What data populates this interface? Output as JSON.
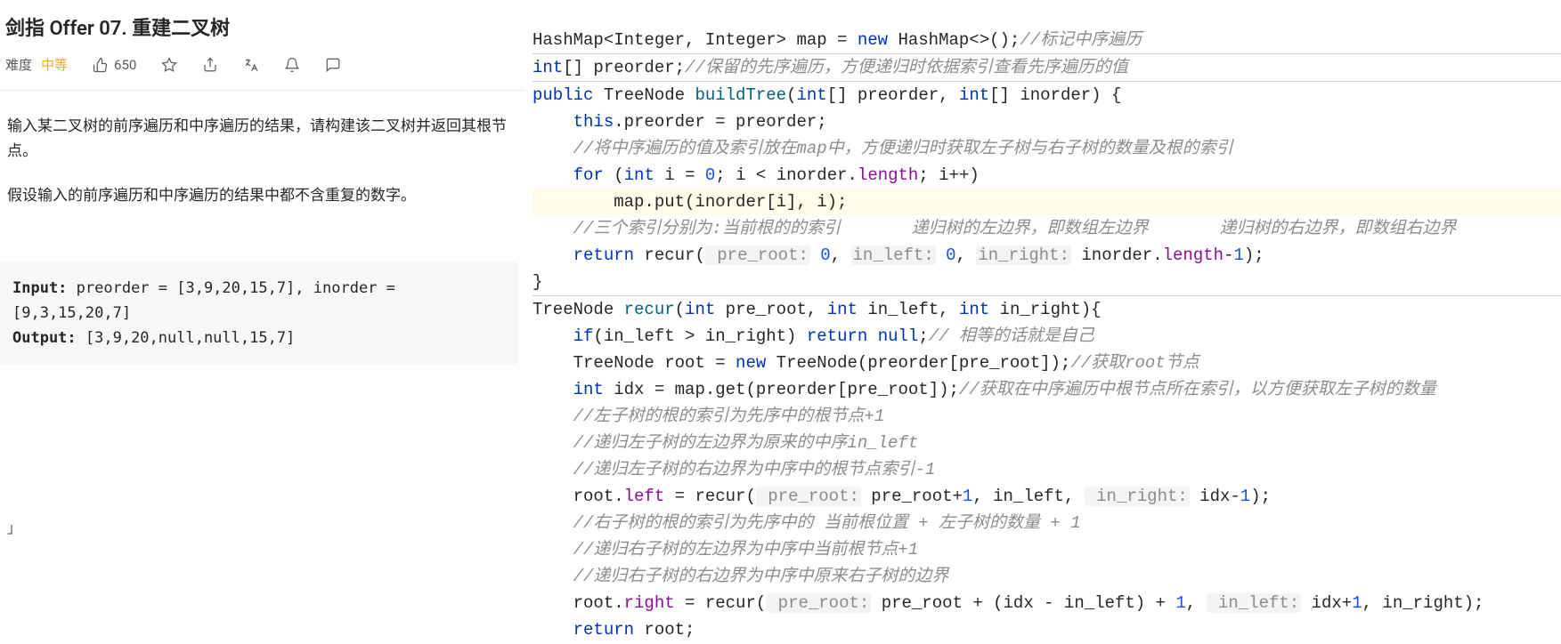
{
  "problem": {
    "title": "剑指 Offer 07. 重建二叉树",
    "difficulty_label": "难度",
    "difficulty_value": "中等",
    "likes": "650",
    "desc1": "输入某二叉树的前序遍历和中序遍历的结果，请构建该二叉树并返回其根节点。",
    "desc2": "假设输入的前序遍历和中序遍历的结果中都不含重复的数字。",
    "example": {
      "input_label": "Input:",
      "input_text": " preorder = [3,9,20,15,7], inorder = [9,3,15,20,7]",
      "output_label": "Output:",
      "output_text": " [3,9,20,null,null,15,7]"
    },
    "trail": "」"
  },
  "code": {
    "l1_a": "HashMap<Integer, Integer> map = ",
    "l1_new": "new",
    "l1_b": " HashMap<>();",
    "l1_c": "//标记中序遍历",
    "l2_a": "int",
    "l2_b": "[] preorder;",
    "l2_c": "//保留的先序遍历，方便递归时依据索引查看先序遍历的值",
    "l3_a": "public",
    "l3_b": " TreeNode ",
    "l3_m": "buildTree",
    "l3_c": "(",
    "l3_int1": "int",
    "l3_d": "[] preorder, ",
    "l3_int2": "int",
    "l3_e": "[] inorder) {",
    "l4_a": "    ",
    "l4_this": "this",
    "l4_b": ".preorder = preorder;",
    "l5": "    //将中序遍历的值及索引放在map中，方便递归时获取左子树与右子树的数量及根的索引",
    "l6_a": "    ",
    "l6_for": "for",
    "l6_b": " (",
    "l6_int": "int",
    "l6_c": " i = ",
    "l6_z": "0",
    "l6_d": "; i < inorder.",
    "l6_len": "length",
    "l6_e": "; i++)",
    "l7_a": "        map.put(inorder[i], i);",
    "l8": "    //三个索引分别为:当前根的的索引       递归树的左边界，即数组左边界       递归树的右边界，即数组右边界",
    "l9_a": "    ",
    "l9_ret": "return",
    "l9_b": " recur(",
    "l9_h1": " pre_root:",
    "l9_z1": " 0",
    "l9_c": ", ",
    "l9_h2": "in_left:",
    "l9_z2": " 0",
    "l9_d": ", ",
    "l9_h3": "in_right:",
    "l9_e": " inorder.",
    "l9_len": "length",
    "l9_f": "-",
    "l9_one": "1",
    "l9_g": ");",
    "l10": "}",
    "l11_a": "TreeNode ",
    "l11_m": "recur",
    "l11_b": "(",
    "l11_int1": "int",
    "l11_c": " pre_root, ",
    "l11_int2": "int",
    "l11_d": " in_left, ",
    "l11_int3": "int",
    "l11_e": " in_right){",
    "l12_a": "    ",
    "l12_if": "if",
    "l12_b": "(in_left > in_right) ",
    "l12_ret": "return null",
    "l12_c": ";",
    "l12_com": "// 相等的话就是自己",
    "l13_a": "    TreeNode root = ",
    "l13_new": "new",
    "l13_b": " TreeNode(preorder[pre_root]);",
    "l13_com": "//获取root节点",
    "l14_a": "    ",
    "l14_int": "int",
    "l14_b": " idx = map.get(preorder[pre_root]);",
    "l14_com": "//获取在中序遍历中根节点所在索引，以方便获取左子树的数量",
    "l15": "    //左子树的根的索引为先序中的根节点+1",
    "l16": "    //递归左子树的左边界为原来的中序in_left",
    "l17": "    //递归左子树的右边界为中序中的根节点索引-1",
    "l18_a": "    root.",
    "l18_left": "left",
    "l18_b": " = recur(",
    "l18_h1": " pre_root:",
    "l18_c": " pre_root+",
    "l18_one": "1",
    "l18_d": ", in_left, ",
    "l18_h2": " in_right:",
    "l18_e": " idx-",
    "l18_one2": "1",
    "l18_f": ");",
    "l19": "    //右子树的根的索引为先序中的 当前根位置 + 左子树的数量 + 1",
    "l20": "    //递归右子树的左边界为中序中当前根节点+1",
    "l21": "    //递归右子树的右边界为中序中原来右子树的边界",
    "l22_a": "    root.",
    "l22_right": "right",
    "l22_b": " = recur(",
    "l22_h1": " pre_root:",
    "l22_c": " pre_root + (idx - in_left) + ",
    "l22_one": "1",
    "l22_d": ", ",
    "l22_h2": " in_left:",
    "l22_e": " idx+",
    "l22_one2": "1",
    "l22_f": ", in_right);",
    "l23_a": "    ",
    "l23_ret": "return",
    "l23_b": " root;"
  }
}
